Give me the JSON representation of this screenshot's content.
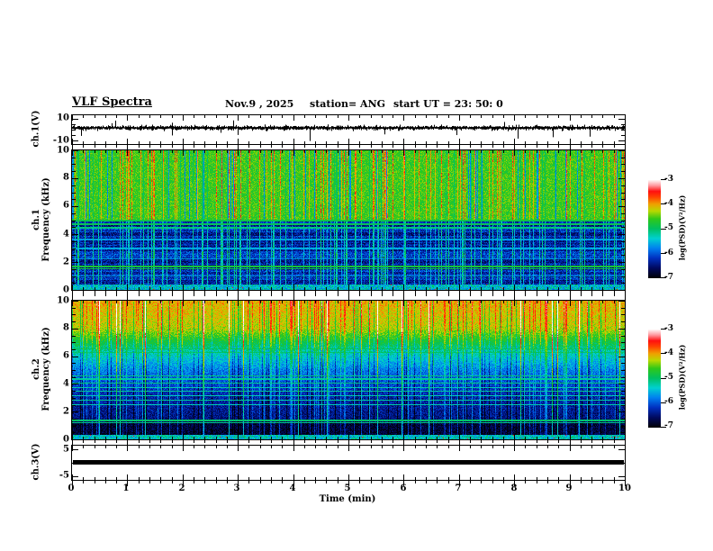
{
  "header": {
    "title": "VLF Spectra",
    "date": "Nov.9 , 2025",
    "station": "station= ANG",
    "start_ut": "start UT =  23: 50: 0"
  },
  "panels": {
    "ch1wave": {
      "ylabel": "ch.1(V)",
      "ytick_top": "10",
      "ytick_bottom": "-10"
    },
    "spec1": {
      "ylabel_line1": "ch.1",
      "ylabel_line2": "Frequency (kHz)",
      "yticks": [
        "10",
        "8",
        "6",
        "4",
        "2",
        "0"
      ]
    },
    "spec2": {
      "ylabel_line1": "ch.2",
      "ylabel_line2": "Frequency (kHz)",
      "yticks": [
        "10",
        "8",
        "6",
        "4",
        "2",
        "0"
      ]
    },
    "ch3": {
      "ylabel": "ch.3(V)",
      "ytick_top": "5",
      "ytick_bottom": "-5"
    }
  },
  "xaxis": {
    "label": "Time (min)",
    "ticks": [
      "0",
      "1",
      "2",
      "3",
      "4",
      "5",
      "6",
      "7",
      "8",
      "9",
      "10"
    ]
  },
  "colorbar": {
    "label": "log(PSD)(V²/Hz)",
    "ticks": [
      "-3",
      "-4",
      "-5",
      "-6",
      "-7"
    ]
  },
  "chart_data": {
    "type": [
      "line",
      "heatmap",
      "heatmap",
      "line"
    ],
    "title": "VLF Spectra",
    "x": {
      "label": "Time (min)",
      "range": [
        0,
        10
      ],
      "major_ticks": [
        0,
        1,
        2,
        3,
        4,
        5,
        6,
        7,
        8,
        9,
        10
      ],
      "minor_step": 0.2
    },
    "value_scale": {
      "label": "log(PSD)(V²/Hz)",
      "range": [
        -7,
        -3
      ]
    },
    "colormap_stops": [
      [
        0.0,
        "#000008"
      ],
      [
        0.1,
        "#000a60"
      ],
      [
        0.2,
        "#0030c0"
      ],
      [
        0.3,
        "#0080f0"
      ],
      [
        0.4,
        "#00d0d0"
      ],
      [
        0.5,
        "#00c060"
      ],
      [
        0.6,
        "#30c818"
      ],
      [
        0.68,
        "#b8d800"
      ],
      [
        0.75,
        "#f0a000"
      ],
      [
        0.82,
        "#ff4400"
      ],
      [
        0.88,
        "#ff1010"
      ],
      [
        0.94,
        "#ff9aa0"
      ],
      [
        1.0,
        "#ffffff"
      ]
    ],
    "seed": 20251109,
    "wave1": {
      "ylabel": "ch.1(V)",
      "yrange": [
        -13,
        13
      ],
      "ytick_vals": [
        10,
        -10
      ],
      "minor_vals": [
        5,
        0,
        -5
      ],
      "center_value": 0,
      "noise_amp": 1.5,
      "spike_prob_down": 0.02,
      "spike_prob_up": 0.015,
      "spike_amp_down": 13,
      "spike_amp_up": 8
    },
    "spec1": {
      "ylabel": "ch.1 Frequency (kHz)",
      "yrange": [
        0,
        10
      ],
      "mode": "split",
      "split_freq": 5.05,
      "hot_prob": 0.1,
      "super_prob": 0.01,
      "dark_prob": 0.07,
      "cyan_prob": 0.07,
      "upper": {
        "base": 0.54,
        "noise": 0.12,
        "hot_base": 0.66,
        "hot_boost": 0.24,
        "dark_base": 0.27,
        "cyan_base": 0.47
      },
      "lower": {
        "base": 0.07,
        "noise": 0.16,
        "streak_boost": 0.3
      },
      "hlines": [
        [
          5.0,
          0.5,
          2
        ],
        [
          4.72,
          0.48,
          2
        ],
        [
          4.45,
          0.44,
          1
        ],
        [
          3.6,
          0.3,
          1
        ],
        [
          2.95,
          0.32,
          1
        ],
        [
          2.2,
          0.3,
          1
        ],
        [
          1.65,
          0.52,
          2
        ],
        [
          1.48,
          0.5,
          1
        ],
        [
          0.95,
          0.3,
          1
        ]
      ],
      "bottom_freq": 0.35,
      "bottom_base": 0.28,
      "bottom_noise": 0.22
    },
    "spec2": {
      "ylabel": "ch.2 Frequency (kHz)",
      "yrange": [
        0,
        10
      ],
      "mode": "gradient",
      "grad": [
        [
          10,
          0.74
        ],
        [
          8,
          0.68
        ],
        [
          6.5,
          0.46
        ],
        [
          5,
          0.3
        ],
        [
          3,
          0.17
        ],
        [
          1.5,
          0.13
        ],
        [
          1.1,
          0.06
        ],
        [
          0,
          0.05
        ]
      ],
      "noise": 0.13,
      "hot_prob": 0.13,
      "hot_boost": 0.18,
      "super_prob": 0.02,
      "super_boost": 0.32,
      "dark_prob": 0.1,
      "dark_cut": 0.12,
      "hlines": [
        [
          6.55,
          0.48,
          1
        ],
        [
          6.3,
          0.46,
          1
        ],
        [
          4.6,
          0.44,
          1
        ],
        [
          4.35,
          0.42,
          1
        ],
        [
          4.05,
          0.44,
          1
        ],
        [
          3.7,
          0.4,
          1
        ],
        [
          3.45,
          0.42,
          1
        ],
        [
          3.15,
          0.4,
          1
        ],
        [
          2.8,
          0.42,
          1
        ],
        [
          2.5,
          0.4,
          1
        ],
        [
          1.35,
          0.46,
          2
        ],
        [
          1.18,
          0.44,
          1
        ]
      ],
      "bottom_freq": 0.32,
      "bottom_base": 0.3,
      "bottom_noise": 0.22
    },
    "ch3": {
      "ylabel": "ch.3(V)",
      "yrange": [
        -6.5,
        6.5
      ],
      "ytick_vals": [
        5,
        -5
      ],
      "line_value": 0.5,
      "line_thickness_px": 5
    },
    "colorbars": [
      {
        "tick_values": [
          -3,
          -4,
          -5,
          -6,
          -7
        ]
      },
      {
        "tick_values": [
          -3,
          -4,
          -5,
          -6,
          -7
        ]
      }
    ]
  }
}
